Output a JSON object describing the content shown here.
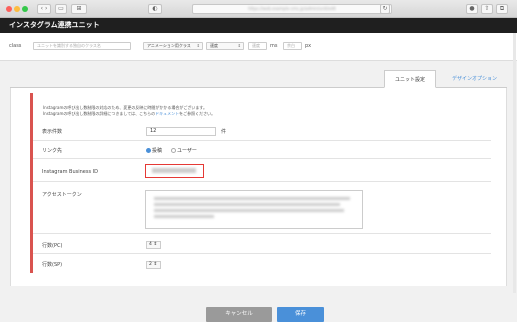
{
  "browser": {
    "url": "https://web.example-cms.jp/admin/unit/edit"
  },
  "app": {
    "title": "インスタグラム連携ユニット"
  },
  "toolbar": {
    "class_label": "class",
    "class_placeholder": "ユニットを識別する独自のクラス名",
    "animation_select": "アニメーション用クラス",
    "speed_select": "速度",
    "ms_value": "速度",
    "ms_unit": "ms",
    "px_value": "余白",
    "px_unit": "px"
  },
  "tabs": [
    {
      "label": "ユニット設定"
    },
    {
      "label": "デザインオプション"
    }
  ],
  "notice": {
    "line1": "Instagramの呼び出し数制限の対応のため、変更の反映に時間がかかる場合がございます。",
    "line2_prefix": "Instagramの呼び出し数制限の詳細につきましては、こちらの",
    "line2_link": "ドキュメント",
    "line2_suffix": "をご参照ください。"
  },
  "fields": {
    "count_label": "表示件数",
    "count_value": "12",
    "count_unit": "件",
    "link_label": "リンク先",
    "link_opt1": "投稿",
    "link_opt2": "ユーザー",
    "business_id_label": "Instagram Business ID",
    "token_label": "アクセストークン",
    "rows_pc_label": "行数(PC)",
    "rows_pc_value": "4",
    "rows_sp_label": "行数(SP)",
    "rows_sp_value": "2"
  },
  "footer": {
    "cancel_label": "キャンセル",
    "save_label": "保存"
  },
  "colors": {
    "accent": "#4a90d9",
    "highlight": "#e53935",
    "title_bar": "#1f1f1f",
    "cancel": "#9a9a9a"
  }
}
